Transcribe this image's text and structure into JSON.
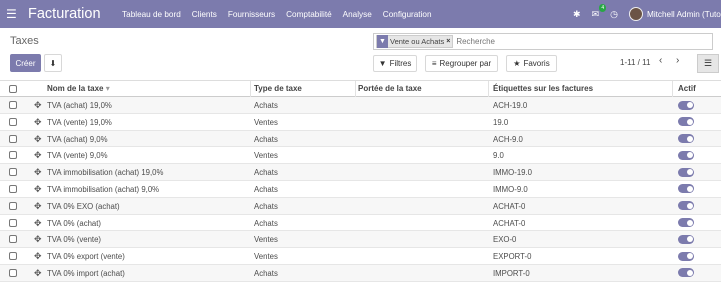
{
  "navbar": {
    "app_name": "Facturation",
    "menu": [
      "Tableau de bord",
      "Clients",
      "Fournisseurs",
      "Comptabilité",
      "Analyse",
      "Configuration"
    ],
    "chat_badge": "4",
    "user_name": "Mitchell Admin (Tuto"
  },
  "control": {
    "breadcrumb": "Taxes",
    "facet_label": "Vente ou Achats",
    "facet_close": "×",
    "search_placeholder": "Recherche",
    "create_label": "Créer",
    "filters_label": "Filtres",
    "groupby_label": "Regrouper par",
    "favorites_label": "Favoris",
    "pager": "1-11 / 11"
  },
  "table": {
    "headers": {
      "name": "Nom de la taxe",
      "type": "Type de taxe",
      "scope": "Portée de la taxe",
      "tags": "Étiquettes sur les factures",
      "active": "Actif"
    },
    "rows": [
      {
        "name": "TVA (achat) 19,0%",
        "type": "Achats",
        "scope": "",
        "tag": "ACH-19.0"
      },
      {
        "name": "TVA (vente) 19,0%",
        "type": "Ventes",
        "scope": "",
        "tag": "19.0"
      },
      {
        "name": "TVA (achat) 9,0%",
        "type": "Achats",
        "scope": "",
        "tag": "ACH-9.0"
      },
      {
        "name": "TVA (vente) 9,0%",
        "type": "Ventes",
        "scope": "",
        "tag": "9.0"
      },
      {
        "name": "TVA immobilisation (achat) 19,0%",
        "type": "Achats",
        "scope": "",
        "tag": "IMMO-19.0"
      },
      {
        "name": "TVA immobilisation (achat) 9,0%",
        "type": "Achats",
        "scope": "",
        "tag": "IMMO-9.0"
      },
      {
        "name": "TVA 0% EXO (achat)",
        "type": "Achats",
        "scope": "",
        "tag": "ACHAT-0"
      },
      {
        "name": "TVA 0% (achat)",
        "type": "Achats",
        "scope": "",
        "tag": "ACHAT-0"
      },
      {
        "name": "TVA 0% (vente)",
        "type": "Ventes",
        "scope": "",
        "tag": "EXO-0"
      },
      {
        "name": "TVA 0% export (vente)",
        "type": "Ventes",
        "scope": "",
        "tag": "EXPORT-0"
      },
      {
        "name": "TVA 0% import (achat)",
        "type": "Achats",
        "scope": "",
        "tag": "IMPORT-0"
      }
    ]
  },
  "colors": {
    "brand": "#7c7bad",
    "active_toggle": "#7c7bad"
  }
}
